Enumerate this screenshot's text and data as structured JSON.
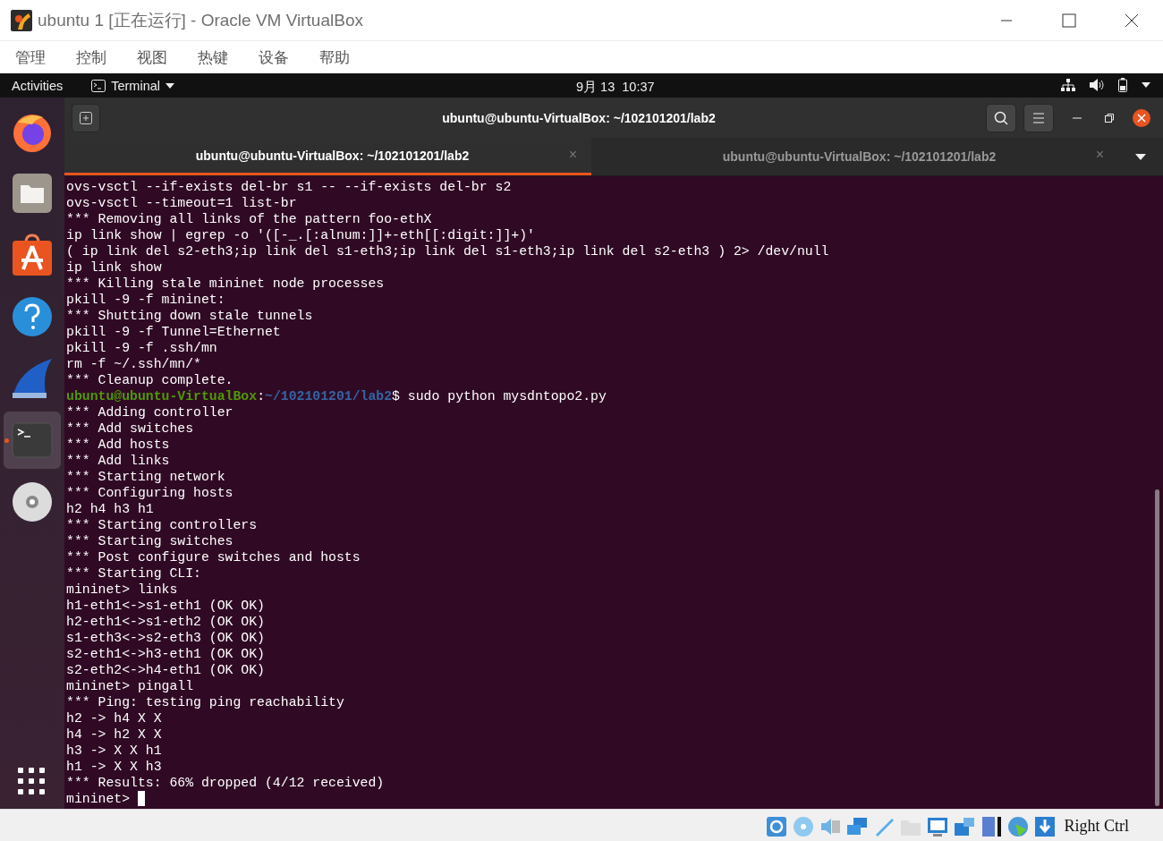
{
  "window": {
    "title": "ubuntu 1 [正在运行] - Oracle VM VirtualBox"
  },
  "menu": [
    "管理",
    "控制",
    "视图",
    "热键",
    "设备",
    "帮助"
  ],
  "top_bar": {
    "activities": "Activities",
    "app": "Terminal",
    "clock": "9月 13  10:37"
  },
  "dock": {
    "items": [
      {
        "kind": "browser",
        "selected": false,
        "running": false
      },
      {
        "kind": "files",
        "selected": false,
        "running": false
      },
      {
        "kind": "store",
        "selected": false,
        "running": false
      },
      {
        "kind": "help",
        "selected": false,
        "running": false
      },
      {
        "kind": "shark",
        "selected": false,
        "running": false
      },
      {
        "kind": "terminal",
        "selected": true,
        "running": true
      },
      {
        "kind": "disc",
        "selected": false,
        "running": false
      }
    ]
  },
  "terminal": {
    "title": "ubuntu@ubuntu-VirtualBox: ~/102101201/lab2",
    "tabs": [
      {
        "label": "ubuntu@ubuntu-VirtualBox: ~/102101201/lab2",
        "selected": true,
        "close": "×"
      },
      {
        "label": "ubuntu@ubuntu-VirtualBox: ~/102101201/lab2",
        "selected": false,
        "close": "×"
      }
    ],
    "lines": [
      {
        "kind": "text",
        "text": "ovs-vsctl --if-exists del-br s1 -- --if-exists del-br s2"
      },
      {
        "kind": "text",
        "text": "ovs-vsctl --timeout=1 list-br"
      },
      {
        "kind": "text",
        "text": "*** Removing all links of the pattern foo-ethX"
      },
      {
        "kind": "text",
        "text": "ip link show | egrep -o '([-_.[:alnum:]]+-eth[[:digit:]]+)'"
      },
      {
        "kind": "text",
        "text": "( ip link del s2-eth3;ip link del s1-eth3;ip link del s1-eth3;ip link del s2-eth3 ) 2> /dev/null"
      },
      {
        "kind": "text",
        "text": "ip link show"
      },
      {
        "kind": "text",
        "text": "*** Killing stale mininet node processes"
      },
      {
        "kind": "text",
        "text": "pkill -9 -f mininet:"
      },
      {
        "kind": "text",
        "text": "*** Shutting down stale tunnels"
      },
      {
        "kind": "text",
        "text": "pkill -9 -f Tunnel=Ethernet"
      },
      {
        "kind": "text",
        "text": "pkill -9 -f .ssh/mn"
      },
      {
        "kind": "text",
        "text": "rm -f ~/.ssh/mn/*"
      },
      {
        "kind": "text",
        "text": "*** Cleanup complete."
      },
      {
        "kind": "prompt",
        "user": "ubuntu@ubuntu-VirtualBox",
        "sep": ":",
        "path": "~/102101201/lab2",
        "text": "$ sudo python mysdntopo2.py"
      },
      {
        "kind": "text",
        "text": "*** Adding controller"
      },
      {
        "kind": "text",
        "text": "*** Add switches"
      },
      {
        "kind": "text",
        "text": "*** Add hosts"
      },
      {
        "kind": "text",
        "text": "*** Add links"
      },
      {
        "kind": "text",
        "text": "*** Starting network"
      },
      {
        "kind": "text",
        "text": "*** Configuring hosts"
      },
      {
        "kind": "text",
        "text": "h2 h4 h3 h1"
      },
      {
        "kind": "text",
        "text": "*** Starting controllers"
      },
      {
        "kind": "text",
        "text": "*** Starting switches"
      },
      {
        "kind": "text",
        "text": "*** Post configure switches and hosts"
      },
      {
        "kind": "text",
        "text": "*** Starting CLI:"
      },
      {
        "kind": "text",
        "text": "mininet> links"
      },
      {
        "kind": "text",
        "text": "h1-eth1<->s1-eth1 (OK OK)"
      },
      {
        "kind": "text",
        "text": "h2-eth1<->s1-eth2 (OK OK)"
      },
      {
        "kind": "text",
        "text": "s1-eth3<->s2-eth3 (OK OK)"
      },
      {
        "kind": "text",
        "text": "s2-eth1<->h3-eth1 (OK OK)"
      },
      {
        "kind": "text",
        "text": "s2-eth2<->h4-eth1 (OK OK)"
      },
      {
        "kind": "text",
        "text": "mininet> pingall"
      },
      {
        "kind": "text",
        "text": "*** Ping: testing ping reachability"
      },
      {
        "kind": "text",
        "text": "h2 -> h4 X X"
      },
      {
        "kind": "text",
        "text": "h4 -> h2 X X"
      },
      {
        "kind": "text",
        "text": "h3 -> X X h1"
      },
      {
        "kind": "text",
        "text": "h1 -> X X h3"
      },
      {
        "kind": "text",
        "text": "*** Results: 66% dropped (4/12 received)"
      },
      {
        "kind": "input",
        "text": "mininet> "
      }
    ]
  },
  "status_bar": {
    "host_key": "Right Ctrl"
  }
}
